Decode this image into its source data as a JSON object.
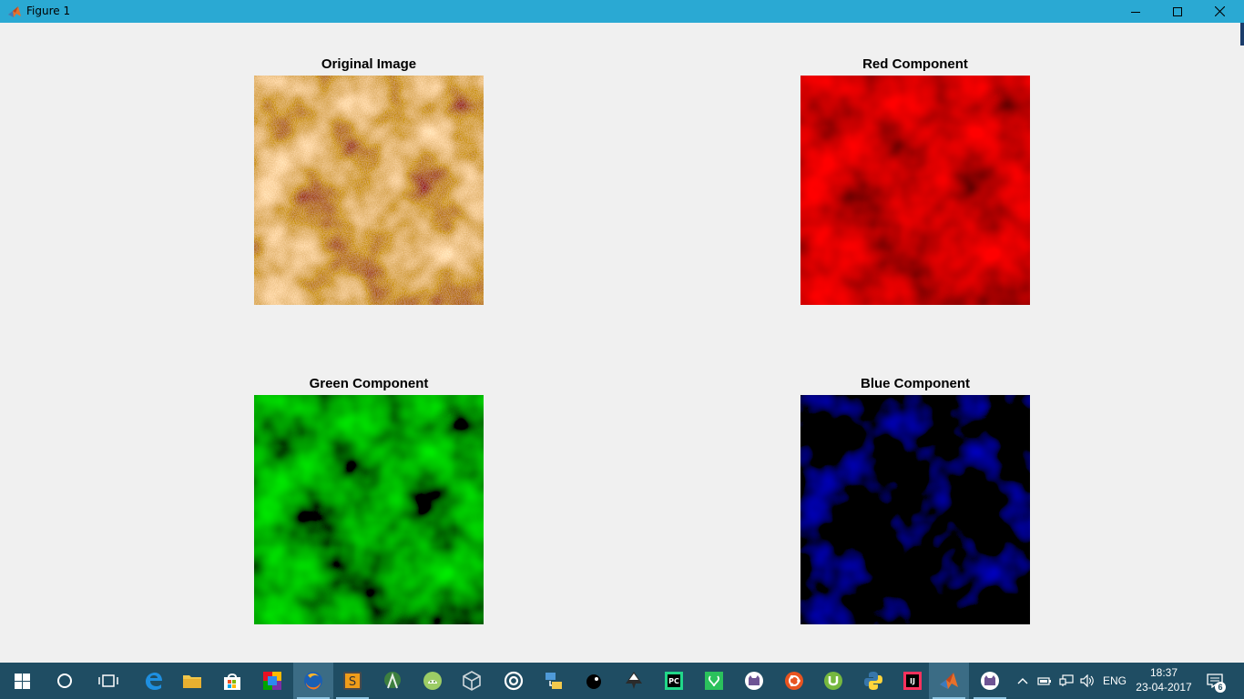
{
  "window": {
    "title": "Figure 1",
    "app_icon": "matlab-icon",
    "controls": [
      "minimize-icon",
      "maximize-icon",
      "close-icon"
    ]
  },
  "figure": {
    "subplots": [
      {
        "title": "Original Image",
        "channel": "rgb",
        "color": "#c9902e"
      },
      {
        "title": "Red Component",
        "channel": "red",
        "color": "#ff0000"
      },
      {
        "title": "Green Component",
        "channel": "green",
        "color": "#00cc00"
      },
      {
        "title": "Blue Component",
        "channel": "blue",
        "color": "#0000ff"
      }
    ]
  },
  "taskbar": {
    "background": "#1f4d63",
    "apps": [
      {
        "name": "start-button",
        "icon": "windows-logo-icon"
      },
      {
        "name": "cortana-button",
        "icon": "circle-icon"
      },
      {
        "name": "task-view-button",
        "icon": "task-view-icon"
      },
      {
        "name": "edge",
        "icon": "edge-icon"
      },
      {
        "name": "file-explorer",
        "icon": "folder-icon"
      },
      {
        "name": "store",
        "icon": "store-icon"
      },
      {
        "name": "tiles",
        "icon": "tiles-icon"
      },
      {
        "name": "firefox",
        "icon": "firefox-icon"
      },
      {
        "name": "sublime-text",
        "icon": "sublime-icon"
      },
      {
        "name": "android-studio",
        "icon": "android-studio-icon"
      },
      {
        "name": "android-emulator",
        "icon": "android-icon"
      },
      {
        "name": "virtualbox",
        "icon": "virtualbox-icon"
      },
      {
        "name": "target-app",
        "icon": "target-icon"
      },
      {
        "name": "network-tool",
        "icon": "network-tool-icon"
      },
      {
        "name": "gimp",
        "icon": "gimp-icon"
      },
      {
        "name": "inkscape",
        "icon": "inkscape-icon"
      },
      {
        "name": "pycharm",
        "icon": "pycharm-icon"
      },
      {
        "name": "saavn",
        "icon": "saavn-icon"
      },
      {
        "name": "github-desktop",
        "icon": "github-cat-icon"
      },
      {
        "name": "ubuntu",
        "icon": "ubuntu-icon"
      },
      {
        "name": "utorrent",
        "icon": "utorrent-icon"
      },
      {
        "name": "python",
        "icon": "python-icon"
      },
      {
        "name": "intellij",
        "icon": "intellij-icon"
      },
      {
        "name": "matlab",
        "icon": "matlab-icon"
      },
      {
        "name": "github-desktop-2",
        "icon": "github-cat-icon"
      }
    ],
    "tray": {
      "chevron": "chevron-up-icon",
      "language": "ENG",
      "time": "18:37",
      "date": "23-04-2017",
      "notification_count": "6"
    }
  }
}
